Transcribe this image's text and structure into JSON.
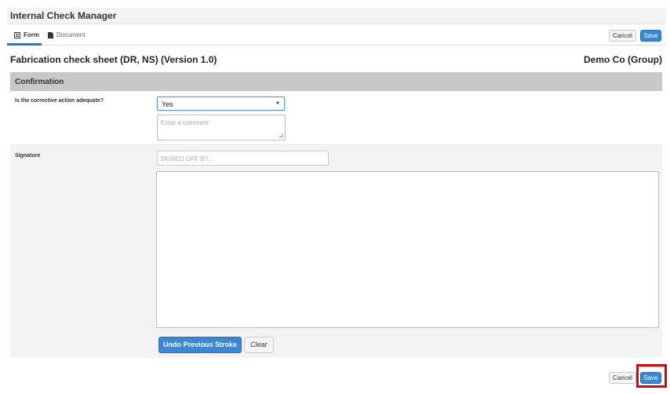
{
  "app": {
    "title": "Internal Check Manager"
  },
  "tabs": [
    {
      "label": "Form",
      "icon": "form-icon",
      "active": true
    },
    {
      "label": "Document",
      "icon": "document-icon",
      "active": false
    }
  ],
  "toolbar": {
    "cancel_label": "Cancel",
    "save_label": "Save"
  },
  "sheet": {
    "title": "Fabrication check sheet (DR, NS) (Version 1.0)",
    "company": "Demo Co (Group)"
  },
  "section": {
    "title": "Confirmation"
  },
  "fields": {
    "corrective_action": {
      "label": "Is the corrective action adequate?",
      "value": "Yes",
      "comment_placeholder": "Enter a comment"
    },
    "signature": {
      "label": "Signature",
      "signed_off_placeholder": "SIGNED OFF BY...",
      "undo_label": "Undo Previous Stroke",
      "clear_label": "Clear"
    }
  },
  "footer": {
    "cancel_label": "Cancel",
    "save_label": "Save"
  },
  "colors": {
    "accent": "#3a87d6",
    "section_bg": "#c8c8c8",
    "highlight": "#e00000"
  }
}
